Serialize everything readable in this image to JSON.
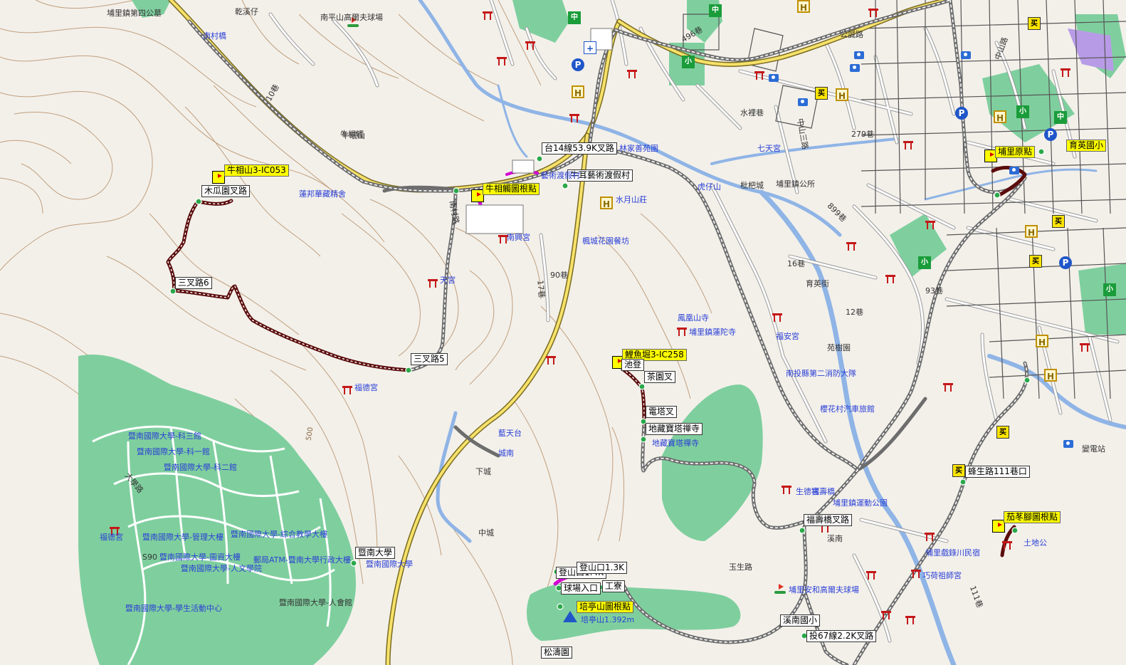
{
  "map": {
    "waypoints": [
      {
        "key": "wp1",
        "label": "牛相山3-IC053",
        "style": "yellow"
      },
      {
        "key": "wp2",
        "label": "木瓜園叉路",
        "style": "white"
      },
      {
        "key": "wp3",
        "label": "三叉路6",
        "style": "white"
      },
      {
        "key": "wp4",
        "label": "三叉路5",
        "style": "white"
      },
      {
        "key": "wp5",
        "label": "牛相觸圖根點",
        "style": "yellow"
      },
      {
        "key": "wp6",
        "label": "台14線53.9K叉路",
        "style": "white"
      },
      {
        "key": "wp7",
        "label": "牛耳藝術渡假村",
        "style": "white"
      },
      {
        "key": "wp8",
        "label": "鯉魚堀3-IC258",
        "style": "yellow"
      },
      {
        "key": "wp9",
        "label": "池登",
        "style": "white"
      },
      {
        "key": "wp10",
        "label": "茶園叉",
        "style": "white"
      },
      {
        "key": "wp11",
        "label": "電塔叉",
        "style": "white"
      },
      {
        "key": "wp12",
        "label": "地藏寶塔禪寺",
        "style": "white"
      },
      {
        "key": "wp13",
        "label": "福壽橋叉路",
        "style": "white"
      },
      {
        "key": "wp14",
        "label": "溪南國小",
        "style": "white"
      },
      {
        "key": "wp15",
        "label": "投67線2.2K叉路",
        "style": "white"
      },
      {
        "key": "wp16",
        "label": "登山口1.4K",
        "style": "white"
      },
      {
        "key": "wp17",
        "label": "登山口1.3K",
        "style": "white"
      },
      {
        "key": "wp18",
        "label": "球場入口",
        "style": "white"
      },
      {
        "key": "wp19",
        "label": "工寮",
        "style": "white"
      },
      {
        "key": "wp20",
        "label": "培亭山圖根點",
        "style": "yellow"
      },
      {
        "key": "wp21",
        "label": "暨南大學",
        "style": "white"
      },
      {
        "key": "wp22",
        "label": "埔里原點",
        "style": "yellow"
      },
      {
        "key": "wp23",
        "label": "育英國小",
        "style": "yellow"
      },
      {
        "key": "wp24",
        "label": "蜂生路111巷口",
        "style": "white"
      },
      {
        "key": "wp25",
        "label": "茄苳腳圖根點",
        "style": "yellow"
      },
      {
        "key": "wp26",
        "label": "松濤園",
        "style": "white"
      }
    ],
    "labels": [
      {
        "key": "l1",
        "text": "埔里鎮第四公墓",
        "cls": "dark"
      },
      {
        "key": "l2",
        "text": "乾溪仔",
        "cls": "dark"
      },
      {
        "key": "l3",
        "text": "南平山高爾夫球場",
        "cls": "dark"
      },
      {
        "key": "l4",
        "text": "南村橋",
        "cls": "blue"
      },
      {
        "key": "l5",
        "text": "牛相觸",
        "cls": "dark"
      },
      {
        "key": "l6",
        "text": "10巷",
        "cls": "dark"
      },
      {
        "key": "l7",
        "text": "蓮邦華藏精舍",
        "cls": "blue"
      },
      {
        "key": "l8",
        "text": "南村路",
        "cls": "dark"
      },
      {
        "key": "l9",
        "text": "南興宮",
        "cls": "blue"
      },
      {
        "key": "l10",
        "text": "天宮",
        "cls": "blue"
      },
      {
        "key": "l11",
        "text": "福德宮",
        "cls": "blue"
      },
      {
        "key": "l12",
        "text": "500",
        "cls": "contour"
      },
      {
        "key": "l13",
        "text": "藝術渡假村",
        "cls": "blue"
      },
      {
        "key": "l14",
        "text": "水月山莊",
        "cls": "blue"
      },
      {
        "key": "l15",
        "text": "楓城花園餐坊",
        "cls": "blue"
      },
      {
        "key": "l16",
        "text": "90巷",
        "cls": "dark"
      },
      {
        "key": "l17",
        "text": "17巷",
        "cls": "dark"
      },
      {
        "key": "l18",
        "text": "林家善苑園",
        "cls": "blue"
      },
      {
        "key": "l19",
        "text": "虎仔山",
        "cls": "dark"
      },
      {
        "key": "l20",
        "text": "枇杷城",
        "cls": "dark"
      },
      {
        "key": "l21",
        "text": "埔里鎮公所",
        "cls": "dark"
      },
      {
        "key": "l22",
        "text": "鳳凰山寺",
        "cls": "blue"
      },
      {
        "key": "l23",
        "text": "16巷",
        "cls": "dark"
      },
      {
        "key": "l24",
        "text": "育英街",
        "cls": "dark"
      },
      {
        "key": "l25",
        "text": "福安宮",
        "cls": "blue"
      },
      {
        "key": "l26",
        "text": "埔里鎮蓮陀寺",
        "cls": "blue"
      },
      {
        "key": "l27",
        "text": "苑樹園",
        "cls": "dark"
      },
      {
        "key": "l28",
        "text": "南投縣第二消防大隊",
        "cls": "blue"
      },
      {
        "key": "l29",
        "text": "櫻花村汽車旅館",
        "cls": "blue"
      },
      {
        "key": "l30",
        "text": "埔里鎮運動公園",
        "cls": "blue"
      },
      {
        "key": "l31",
        "text": "生德宮",
        "cls": "blue"
      },
      {
        "key": "l32",
        "text": "玉生路",
        "cls": "dark"
      },
      {
        "key": "l33",
        "text": "埔里安和高爾夫球場",
        "cls": "blue"
      },
      {
        "key": "l34",
        "text": "溪南",
        "cls": "dark"
      },
      {
        "key": "l35",
        "text": "埔里戲錄川民宿",
        "cls": "blue"
      },
      {
        "key": "l36",
        "text": "巧荷祖師宮",
        "cls": "blue"
      },
      {
        "key": "l37",
        "text": "土地公",
        "cls": "blue"
      },
      {
        "key": "l38",
        "text": "111巷",
        "cls": "dark"
      },
      {
        "key": "l39",
        "text": "暨南國際大學-科三館",
        "cls": "blue"
      },
      {
        "key": "l40",
        "text": "暨南國際大學-科一館",
        "cls": "blue"
      },
      {
        "key": "l41",
        "text": "暨南國際大學-科二館",
        "cls": "blue"
      },
      {
        "key": "l42",
        "text": "大學路",
        "cls": "dark"
      },
      {
        "key": "l43",
        "text": "暨南國際大學-管理大樓",
        "cls": "blue"
      },
      {
        "key": "l44",
        "text": "暨南國際大學-綜合教學大樓",
        "cls": "blue"
      },
      {
        "key": "l45",
        "text": "暨南國際大學-圖資大樓",
        "cls": "blue"
      },
      {
        "key": "l46",
        "text": "郵局ATM-暨南大學行政大樓",
        "cls": "blue"
      },
      {
        "key": "l47",
        "text": "暨南國際大學-人文學院",
        "cls": "blue"
      },
      {
        "key": "l48",
        "text": "暨南國際大學-學生活動中心",
        "cls": "blue"
      },
      {
        "key": "l49",
        "text": "暨南國際大學-人會館",
        "cls": "dark"
      },
      {
        "key": "l50",
        "text": "福德宮",
        "cls": "blue"
      },
      {
        "key": "l51",
        "text": "暨南國際大學",
        "cls": "blue"
      },
      {
        "key": "l52",
        "text": "中山路",
        "cls": "dark"
      },
      {
        "key": "l53",
        "text": "93巷",
        "cls": "dark"
      },
      {
        "key": "l54",
        "text": "水裡巷",
        "cls": "dark"
      },
      {
        "key": "l55",
        "text": "公誠路",
        "cls": "dark"
      },
      {
        "key": "l56",
        "text": "496巷",
        "cls": "dark"
      },
      {
        "key": "l57",
        "text": "279巷",
        "cls": "dark"
      },
      {
        "key": "l58",
        "text": "899巷",
        "cls": "dark"
      },
      {
        "key": "l59",
        "text": "12巷",
        "cls": "dark"
      },
      {
        "key": "l60",
        "text": "變電站",
        "cls": "dark"
      },
      {
        "key": "l61",
        "text": "中山三路",
        "cls": "dark"
      },
      {
        "key": "l62",
        "text": "七天宮",
        "cls": "blue"
      },
      {
        "key": "l63",
        "text": "藍天台",
        "cls": "blue"
      },
      {
        "key": "l64",
        "text": "下城",
        "cls": "dark"
      },
      {
        "key": "l65",
        "text": "城南",
        "cls": "blue"
      },
      {
        "key": "l66",
        "text": "中城",
        "cls": "dark"
      },
      {
        "key": "l67",
        "text": "牛眠山",
        "cls": "dark"
      },
      {
        "key": "l68",
        "text": "S90",
        "cls": "dark"
      },
      {
        "key": "l69",
        "text": "地藏寶塔禪寺",
        "cls": "blue"
      },
      {
        "key": "l70",
        "text": "福壽橋",
        "cls": "blue"
      },
      {
        "key": "l71",
        "text": "培亭山1.392m",
        "cls": "blue"
      }
    ]
  }
}
